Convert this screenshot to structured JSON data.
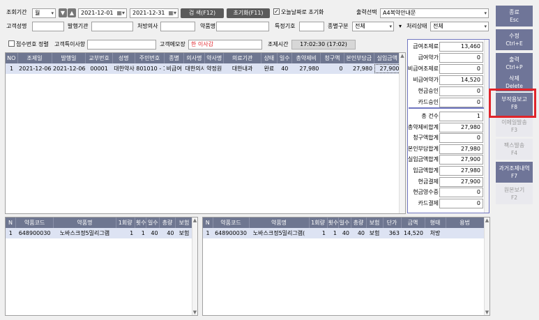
{
  "filters": {
    "period_label": "조회기간",
    "period_unit": "월",
    "date_from": "2021-12-01",
    "date_to": "2021-12-31",
    "search_button": "검 색(F12)",
    "reset_button": "초기화(F11)",
    "today_reset_label": "오늘날짜로 초기화",
    "output_label": "출력선택",
    "output_value": "A4복약안내문",
    "patient_name_label": "고객성명",
    "issuer_label": "발행기관",
    "doctor_label": "처방의사",
    "drug_name_label": "약품명",
    "special_code_label": "특정기호",
    "category_label": "종별구분",
    "category_value": "전체",
    "status_label": "처리상태",
    "status_value": "전체"
  },
  "row2": {
    "receipt_sort_label": "접수번호 정렬",
    "customer_note_label": "고객특이사항",
    "customer_memo_label": "고객메모장",
    "customer_memo_value": "한 이사감",
    "dispense_time_label": "조제시간",
    "dispense_time_value": "17:02:30 (17:02)"
  },
  "main_table": {
    "columns": [
      "NO",
      "조제일",
      "발행일",
      "교부번호",
      "성명",
      "주민번호",
      "종별",
      "의사명",
      "약사명",
      "의료기관",
      "상태",
      "일수",
      "총약제비",
      "청구액",
      "본인부담금",
      "실입금액"
    ],
    "rows": [
      [
        "1",
        "2021-12-06",
        "2021-12-06",
        "00001",
        "대한약사",
        "801010 - 1",
        "비급여",
        "대한의사",
        "약정원",
        "대한내과",
        "완료",
        "40",
        "27,980",
        "0",
        "27,980",
        "27,900"
      ]
    ]
  },
  "summary_top": [
    {
      "label": "급여조제료",
      "value": "13,460"
    },
    {
      "label": "급여약가",
      "value": "0"
    },
    {
      "label": "비급여조제료",
      "value": "0"
    },
    {
      "label": "비급여약가",
      "value": "14,520"
    },
    {
      "label": "현금승인",
      "value": "0"
    },
    {
      "label": "카드승인",
      "value": "0"
    }
  ],
  "summary_bottom": [
    {
      "label": "총 건수",
      "value": "1"
    },
    {
      "label": "총약제비합계",
      "value": "27,980"
    },
    {
      "label": "청구액합계",
      "value": "0"
    },
    {
      "label": "본인부담합계",
      "value": "27,980"
    },
    {
      "label": "실입금액합계",
      "value": "27,900"
    },
    {
      "label": "입금액합계",
      "value": "27,980"
    },
    {
      "label": "현금결제",
      "value": "27,900"
    },
    {
      "label": "현금영수증",
      "value": "0"
    },
    {
      "label": "카드결제",
      "value": "0"
    }
  ],
  "side_buttons": [
    {
      "label": "종료",
      "key": "Esc"
    },
    {
      "label": "수정",
      "key": "Ctrl+E"
    },
    {
      "label": "출력",
      "key": "Ctrl+P"
    },
    {
      "label": "삭제",
      "key": "Delete"
    },
    {
      "label": "부작용보고",
      "key": "F8"
    },
    {
      "label": "이메일발송",
      "key": "F3"
    },
    {
      "label": "팩스발송",
      "key": "F4"
    },
    {
      "label": "과거조제내역",
      "key": "F7"
    },
    {
      "label": "원본보기",
      "key": "F2"
    }
  ],
  "drug_table_left": {
    "columns": [
      "N",
      "약품코드",
      "약품명",
      "1회량",
      "횟수",
      "일수",
      "총량",
      "보험"
    ],
    "rows": [
      [
        "1",
        "648900030",
        "노바스크정5밀리그램",
        "1",
        "1",
        "40",
        "40",
        "보험"
      ]
    ]
  },
  "drug_table_right": {
    "columns": [
      "N",
      "약품코드",
      "약품명",
      "1회량",
      "횟수",
      "일수",
      "총량",
      "보험",
      "단가",
      "금액",
      "형태",
      "용법"
    ],
    "rows": [
      [
        "1",
        "648900030",
        "노바스크정5밀리그램(",
        "1",
        "1",
        "40",
        "40",
        "보험",
        "363",
        "14,520",
        "처방",
        ""
      ]
    ]
  },
  "colors": {
    "header": "#6e7690",
    "side_button": "#6f7598",
    "highlight": "#e0242a",
    "memo_text": "#e0242a"
  },
  "icons": {
    "dropdown": "chevron-down-icon",
    "calendar": "calendar-icon",
    "prev": "arrow-down-icon",
    "next": "arrow-up-icon"
  }
}
